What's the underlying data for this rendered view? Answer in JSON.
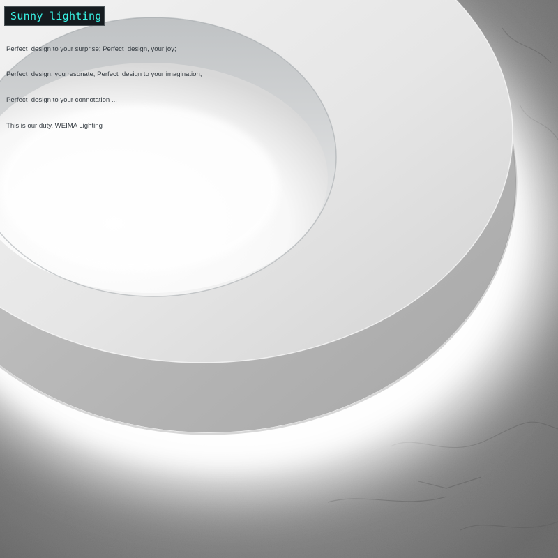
{
  "brand": {
    "title": "Sunny lighting",
    "title_color": "#39f4e6",
    "badge_color": "#151b1f"
  },
  "tagline": {
    "lines": [
      "Perfect  design to your surprise; Perfect  design, your joy;",
      "Perfect  design, you resonate; Perfect  design to your imagination;",
      "Perfect  design to your connotation ...",
      "This is our duty. WEIMA Lighting"
    ]
  },
  "photo": {
    "subject": "white round LED ceiling lamp with backlit halo on textured plaster wall",
    "lamp_color": "#f4f4f4",
    "wall_color": "#8a8a8a",
    "glow_color": "#ffffff"
  }
}
